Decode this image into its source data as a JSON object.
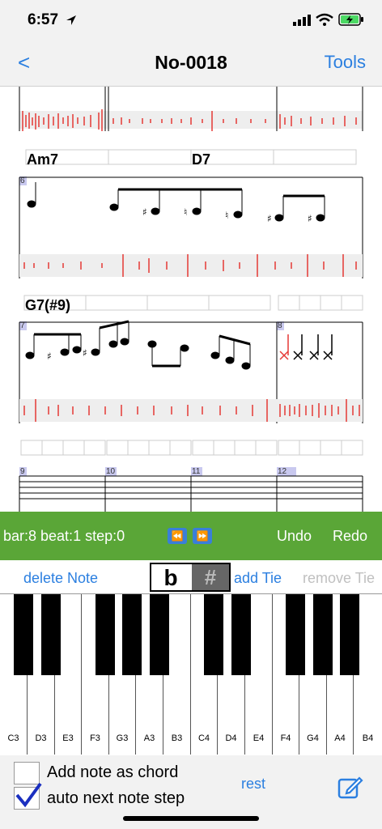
{
  "status": {
    "time": "6:57"
  },
  "nav": {
    "back": "<",
    "title": "No-0018",
    "tools": "Tools"
  },
  "score": {
    "chords": [
      "Am7",
      "D7",
      "G7(#9)"
    ],
    "bar_numbers": [
      "6",
      "7",
      "8",
      "9",
      "10",
      "11",
      "12"
    ]
  },
  "transport": {
    "position": "bar:8  beat:1  step:0",
    "rewind": "⏪",
    "forward": "⏩",
    "undo": "Undo",
    "redo": "Redo"
  },
  "actions": {
    "delete_note": "delete Note",
    "flat": "b",
    "sharp": "#",
    "add_tie": "add Tie",
    "remove_tie": "remove Tie"
  },
  "keyboard": {
    "white_keys": [
      "C3",
      "D3",
      "E3",
      "F3",
      "G3",
      "A3",
      "B3",
      "C4",
      "D4",
      "E4",
      "F4",
      "G4",
      "A4",
      "B4"
    ]
  },
  "options": {
    "chord_label": "Add note as chord",
    "chord_checked": false,
    "auto_label": "auto next note step",
    "auto_checked": true,
    "rest": "rest"
  },
  "colors": {
    "accent": "#2b7fe0",
    "green": "#5aa637",
    "waveform": "#e53935"
  }
}
